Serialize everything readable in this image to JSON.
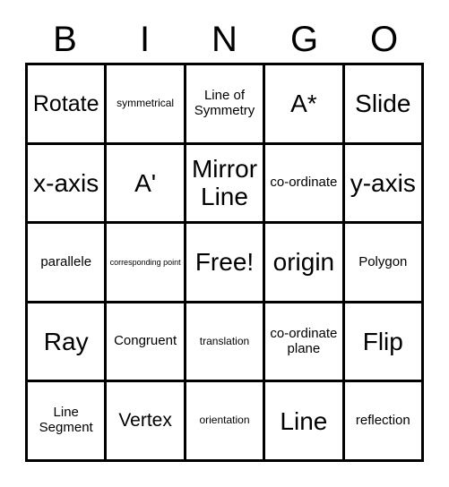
{
  "card": {
    "header": {
      "letters": [
        "B",
        "I",
        "N",
        "G",
        "O"
      ]
    },
    "grid": {
      "columns": 5,
      "rows": 5,
      "free_space": "Free!",
      "cells": [
        [
          {
            "label": "Rotate",
            "size": "lg"
          },
          {
            "label": "symmetrical",
            "size": "xs"
          },
          {
            "label": "Line of Symmetry",
            "size": "sm"
          },
          {
            "label": "A*",
            "size": "xl"
          },
          {
            "label": "Slide",
            "size": "xl"
          }
        ],
        [
          {
            "label": "x-axis",
            "size": "xl"
          },
          {
            "label": "A'",
            "size": "xl"
          },
          {
            "label": "Mirror Line",
            "size": "xl"
          },
          {
            "label": "co-ordinate",
            "size": "sm"
          },
          {
            "label": "y-axis",
            "size": "xl"
          }
        ],
        [
          {
            "label": "parallele",
            "size": "sm"
          },
          {
            "label": "corresponding point",
            "size": "xxs"
          },
          {
            "label": "Free!",
            "size": "xl"
          },
          {
            "label": "origin",
            "size": "xl"
          },
          {
            "label": "Polygon",
            "size": "sm"
          }
        ],
        [
          {
            "label": "Ray",
            "size": "xl"
          },
          {
            "label": "Congruent",
            "size": "sm"
          },
          {
            "label": "translation",
            "size": "xs"
          },
          {
            "label": "co-ordinate plane",
            "size": "sm"
          },
          {
            "label": "Flip",
            "size": "xl"
          }
        ],
        [
          {
            "label": "Line Segment",
            "size": "sm"
          },
          {
            "label": "Vertex",
            "size": "md"
          },
          {
            "label": "orientation",
            "size": "xs"
          },
          {
            "label": "Line",
            "size": "xl"
          },
          {
            "label": "reflection",
            "size": "sm"
          }
        ]
      ]
    },
    "colors": {
      "background": "#ffffff",
      "text": "#000000",
      "border": "#000000"
    }
  }
}
